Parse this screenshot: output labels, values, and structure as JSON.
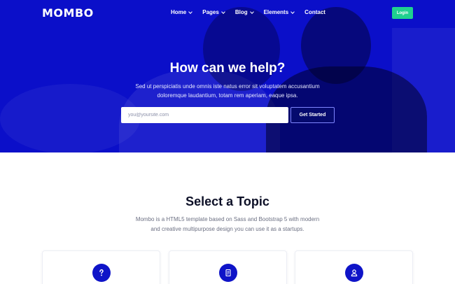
{
  "nav": {
    "logo": "MOMBO",
    "items": [
      {
        "label": "Home",
        "has_dropdown": true
      },
      {
        "label": "Pages",
        "has_dropdown": true
      },
      {
        "label": "Blog",
        "has_dropdown": true
      },
      {
        "label": "Elements",
        "has_dropdown": true
      },
      {
        "label": "Contact",
        "has_dropdown": false
      }
    ],
    "login_label": "Login"
  },
  "hero": {
    "title": "How can we help?",
    "subtitle": "Sed ut perspiciatis unde omnis iste natus error sit voluptatem accusantium doloremque laudantium, totam rem aperiam, eaque ipsa.",
    "email_placeholder": "you@yoursite.com",
    "cta_label": "Get Started"
  },
  "topics": {
    "title": "Select a Topic",
    "description": "Mombo is a HTML5 template based on Sass and Bootstrap 5 with modern and creative multipurpose design you can use it as a startups.",
    "cards": [
      {
        "icon": "question-icon"
      },
      {
        "icon": "document-icon"
      },
      {
        "icon": "user-icon"
      }
    ]
  },
  "colors": {
    "hero_blue": "#0b0fc9",
    "login_green": "#1fd18f",
    "icon_blue": "#0f14c8"
  }
}
